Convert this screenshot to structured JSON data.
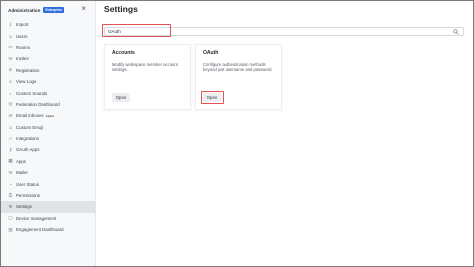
{
  "sidebar": {
    "title": "Administration",
    "badge": "Enterprise",
    "items": [
      {
        "label": "Import",
        "icon": "import-icon"
      },
      {
        "label": "Users",
        "icon": "users-icon"
      },
      {
        "label": "Rooms",
        "icon": "rooms-icon"
      },
      {
        "label": "Invites",
        "icon": "invites-icon"
      },
      {
        "label": "Registration",
        "icon": "registration-icon"
      },
      {
        "label": "View Logs",
        "icon": "logs-icon"
      },
      {
        "label": "Custom Sounds",
        "icon": "sounds-icon"
      },
      {
        "label": "Federation Dashboard",
        "icon": "federation-icon"
      },
      {
        "label": "Email Inboxes",
        "icon": "email-icon",
        "tag": "Alpha"
      },
      {
        "label": "Custom Emoji",
        "icon": "emoji-icon"
      },
      {
        "label": "Integrations",
        "icon": "integrations-icon"
      },
      {
        "label": "OAuth Apps",
        "icon": "oauth-icon"
      },
      {
        "label": "Apps",
        "icon": "apps-icon"
      },
      {
        "label": "Mailer",
        "icon": "mailer-icon"
      },
      {
        "label": "User Status",
        "icon": "user-status-icon"
      },
      {
        "label": "Permissions",
        "icon": "permissions-icon"
      },
      {
        "label": "Settings",
        "icon": "settings-icon",
        "active": true
      },
      {
        "label": "Device management",
        "icon": "device-icon"
      },
      {
        "label": "Engagement Dashboard",
        "icon": "engagement-icon"
      }
    ]
  },
  "main": {
    "title": "Settings",
    "search": {
      "value": "OAuth",
      "placeholder": "Search"
    },
    "cards": [
      {
        "title": "Accounts",
        "description": "Modify workspace member account settings.",
        "button": "Open"
      },
      {
        "title": "OAuth",
        "description": "Configure authentication methods beyond just username and password.",
        "button": "Open"
      }
    ]
  },
  "colors": {
    "accent": "#2f6fdd",
    "highlight": "#e05252",
    "active_item": "#dfe2e6"
  }
}
